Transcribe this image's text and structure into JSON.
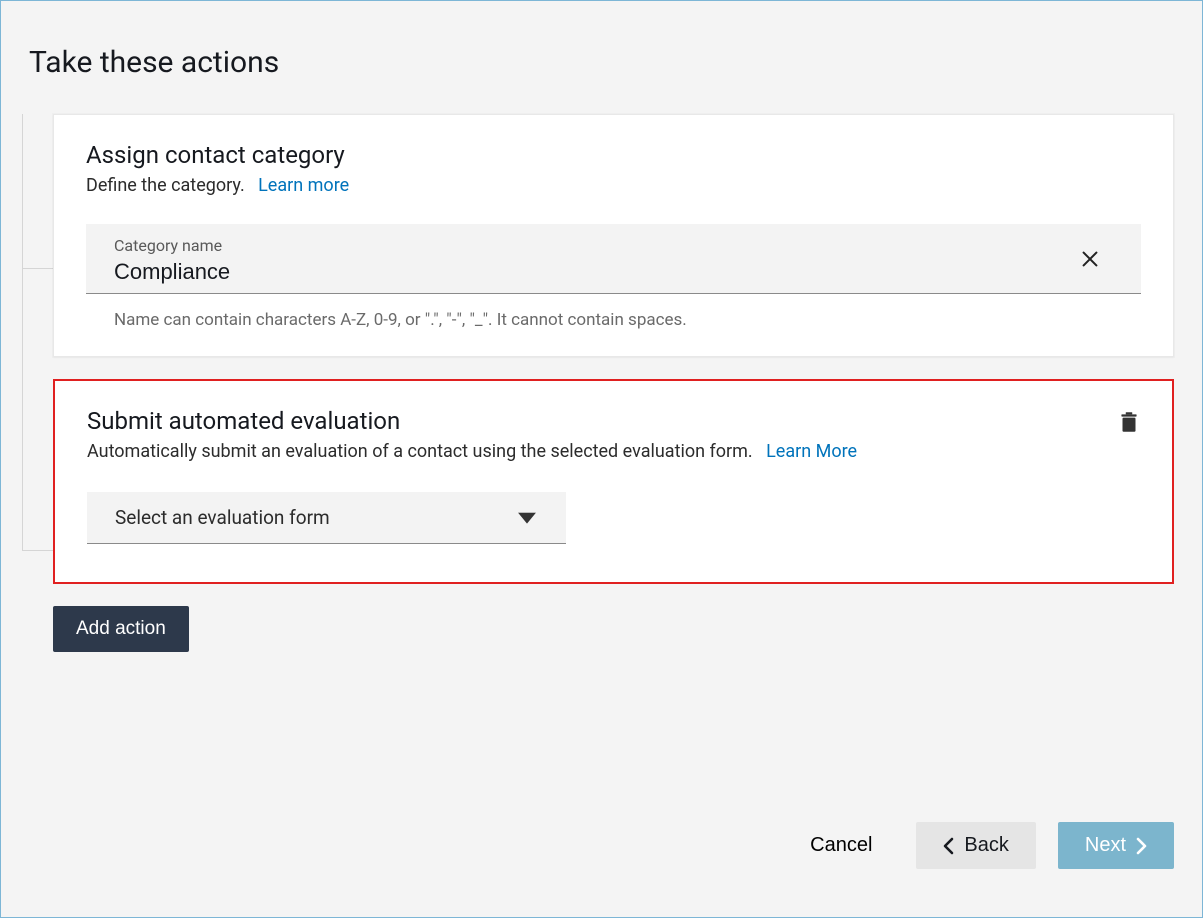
{
  "page": {
    "title": "Take these actions"
  },
  "card1": {
    "title": "Assign contact category",
    "subtitle": "Define the category.",
    "learn_more": "Learn more",
    "input_label": "Category name",
    "input_value": "Compliance",
    "hint": "Name can contain characters A-Z, 0-9, or \".\", \"-\", \"_\". It cannot contain spaces."
  },
  "card2": {
    "title": "Submit automated evaluation",
    "subtitle": "Automatically submit an evaluation of a contact using the selected evaluation form.",
    "learn_more": "Learn More",
    "select_placeholder": "Select an evaluation form"
  },
  "buttons": {
    "add_action": "Add action",
    "cancel": "Cancel",
    "back": "Back",
    "next": "Next"
  }
}
